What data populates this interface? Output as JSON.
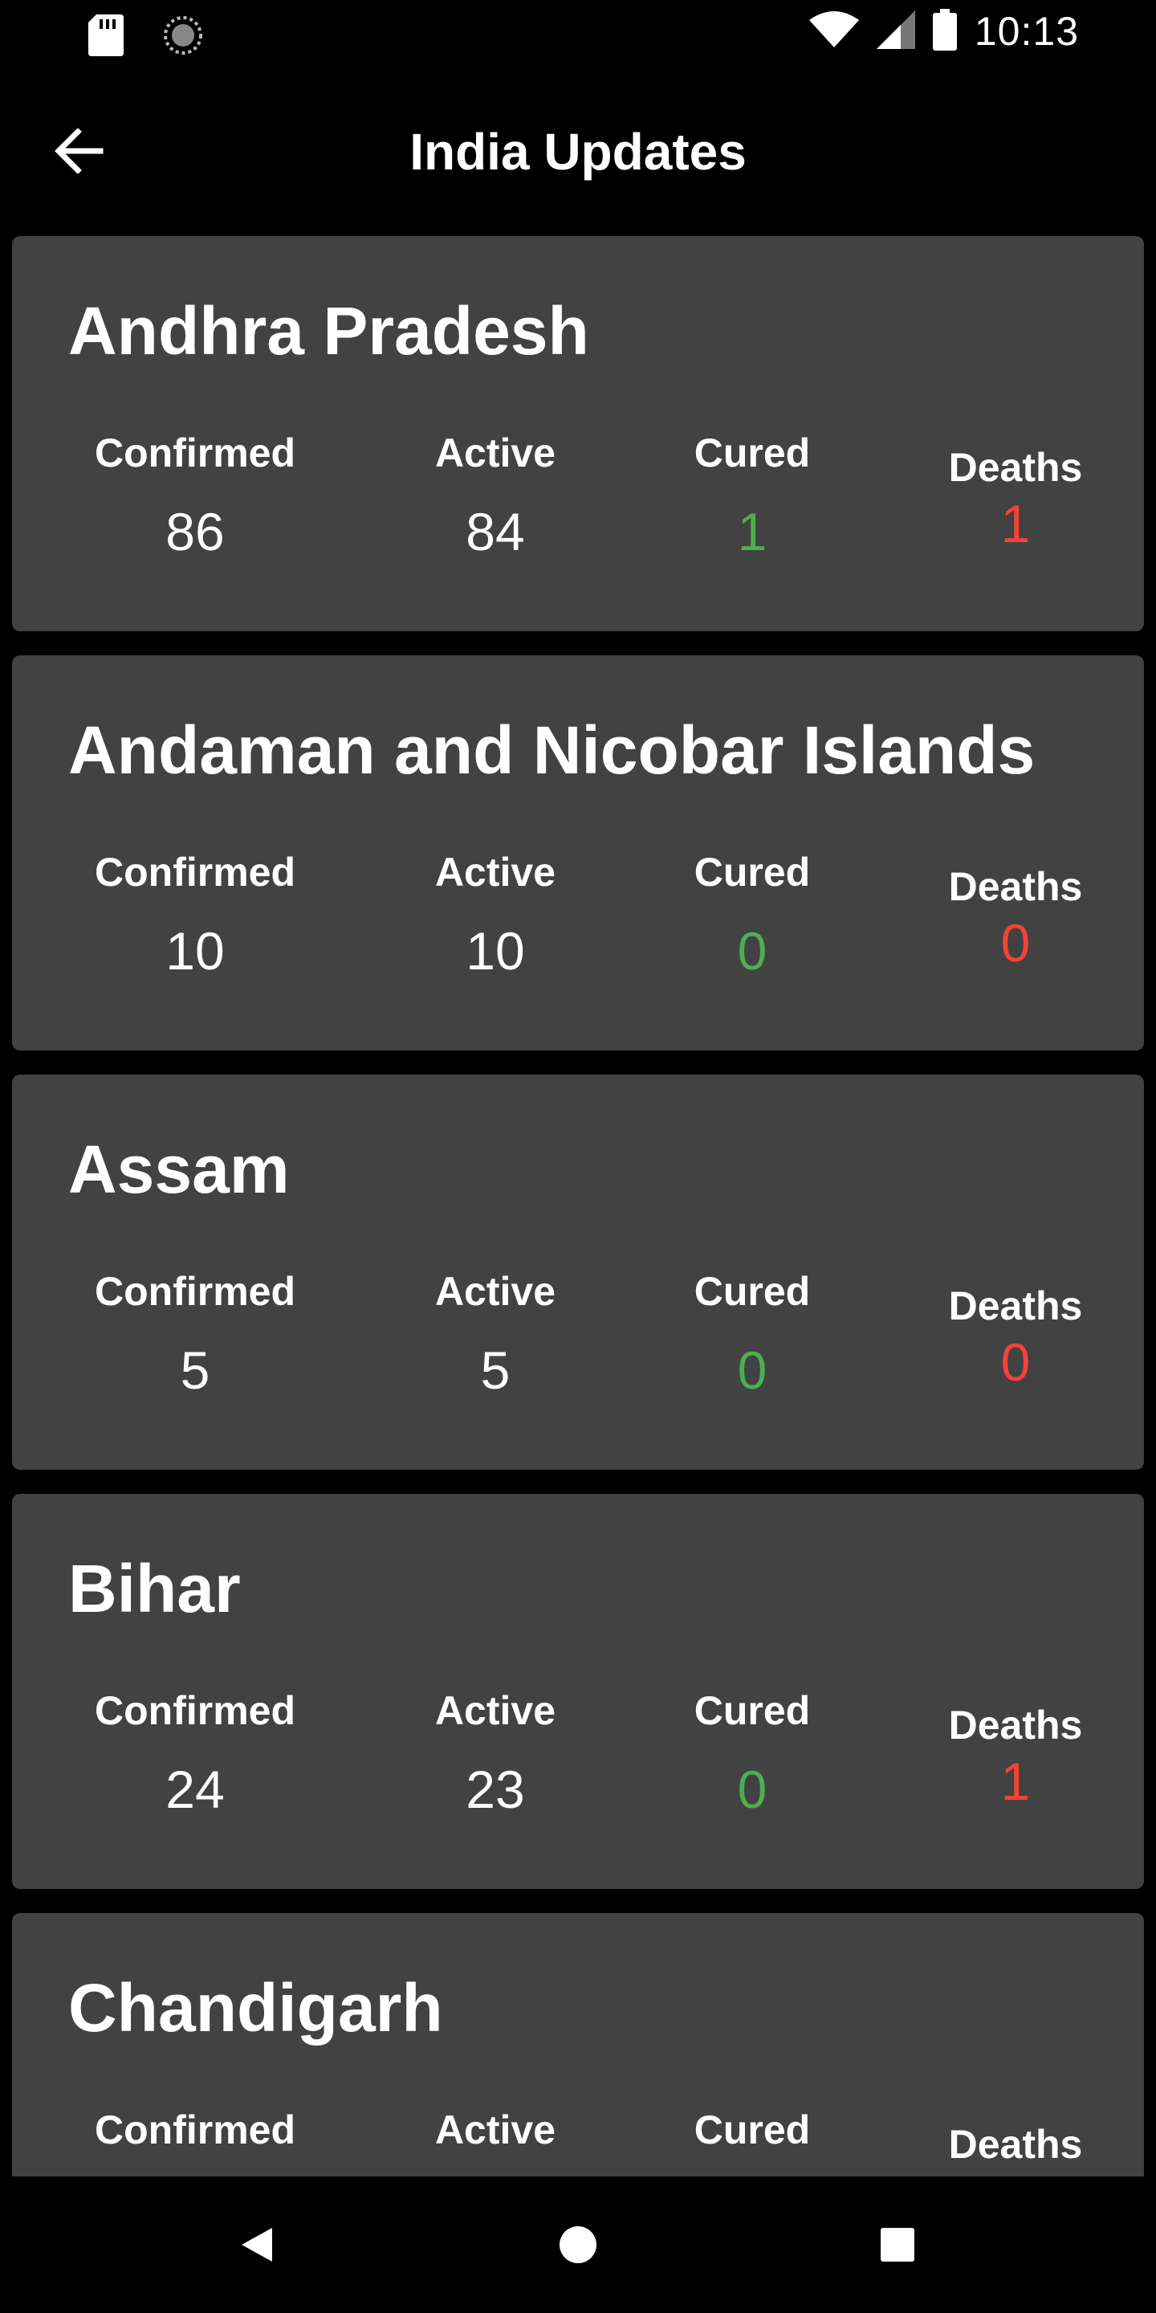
{
  "status_bar": {
    "time": "10:13",
    "icons": [
      "sd-card-icon",
      "sync-icon",
      "wifi-icon",
      "signal-icon",
      "battery-icon"
    ]
  },
  "app_bar": {
    "title": "India Updates",
    "back_icon": "arrow-left-icon"
  },
  "colors": {
    "background": "#000000",
    "card": "#424242",
    "cured": "#4CAF50",
    "deaths": "#F44336"
  },
  "labels": {
    "confirmed": "Confirmed",
    "active": "Active",
    "cured": "Cured",
    "deaths": "Deaths"
  },
  "states": [
    {
      "name": "Andhra Pradesh",
      "confirmed": "86",
      "active": "84",
      "cured": "1",
      "deaths": "1"
    },
    {
      "name": "Andaman and Nicobar Islands",
      "confirmed": "10",
      "active": "10",
      "cured": "0",
      "deaths": "0"
    },
    {
      "name": "Assam",
      "confirmed": "5",
      "active": "5",
      "cured": "0",
      "deaths": "0"
    },
    {
      "name": "Bihar",
      "confirmed": "24",
      "active": "23",
      "cured": "0",
      "deaths": "1"
    },
    {
      "name": "Chandigarh",
      "confirmed": "",
      "active": "",
      "cured": "",
      "deaths": ""
    }
  ],
  "nav_bar": {
    "icons": [
      "back-triangle-icon",
      "home-circle-icon",
      "recents-square-icon"
    ]
  }
}
